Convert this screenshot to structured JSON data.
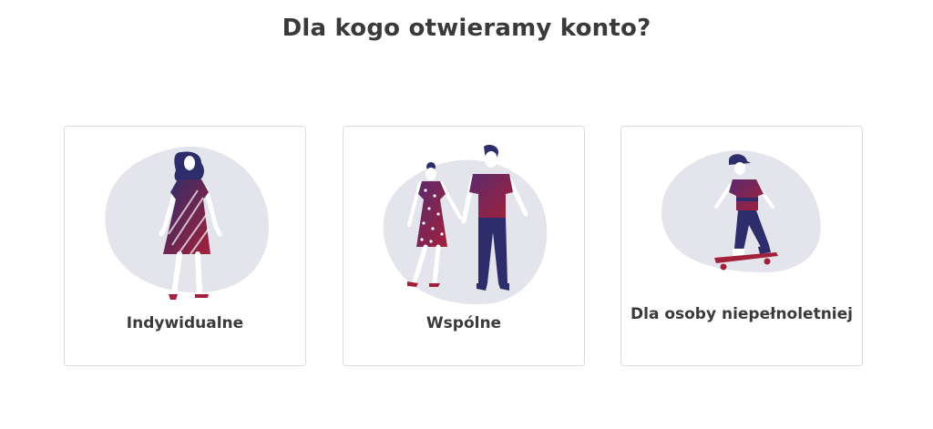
{
  "header": {
    "title": "Dla kogo otwieramy konto?"
  },
  "options": [
    {
      "label": "Indywidualne",
      "icon": "woman-in-dress-icon"
    },
    {
      "label": "Wspólne",
      "icon": "couple-holding-hands-icon"
    },
    {
      "label": "Dla osoby niepełnoletniej",
      "icon": "skateboarder-icon"
    }
  ],
  "colors": {
    "title_text": "#3a3a3c",
    "card_border": "#dcdcdf",
    "blob": "#e4e5ec",
    "navy": "#2d2d6b",
    "crimson": "#a2213a",
    "purple": "#5a2a6e"
  }
}
